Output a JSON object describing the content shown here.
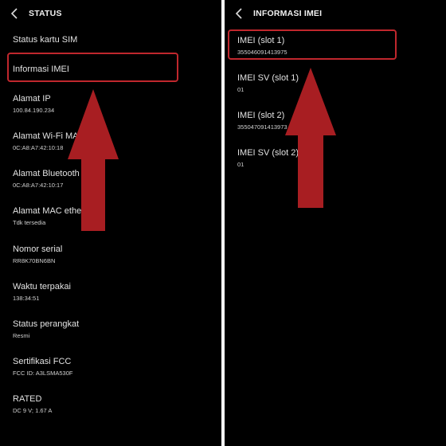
{
  "left": {
    "title": "STATUS",
    "items": [
      {
        "title": "Status kartu SIM",
        "sub": ""
      },
      {
        "title": "Informasi IMEI",
        "sub": ""
      },
      {
        "title": "Alamat IP",
        "sub": "100.84.190.234"
      },
      {
        "title": "Alamat Wi-Fi MAC",
        "sub": "0C:A8:A7:42:10:18"
      },
      {
        "title": "Alamat Bluetooth",
        "sub": "0C:A8:A7:42:10:17"
      },
      {
        "title": "Alamat MAC ethernet",
        "sub": "Tdk tersedia"
      },
      {
        "title": "Nomor serial",
        "sub": "RR8K70BN6BN"
      },
      {
        "title": "Waktu terpakai",
        "sub": "138:34:51"
      },
      {
        "title": "Status perangkat",
        "sub": "Resmi"
      },
      {
        "title": "Sertifikasi FCC",
        "sub": "FCC ID: A3LSMA530F"
      },
      {
        "title": "RATED",
        "sub": "DC 9 V; 1.67 A"
      }
    ]
  },
  "right": {
    "title": "INFORMASI IMEI",
    "items": [
      {
        "title": "IMEI (slot 1)",
        "sub": "355046091413975"
      },
      {
        "title": "IMEI SV (slot 1)",
        "sub": "01"
      },
      {
        "title": "IMEI (slot 2)",
        "sub": "355047091413973"
      },
      {
        "title": "IMEI SV (slot 2)",
        "sub": "01"
      }
    ]
  },
  "colors": {
    "background": "#000000",
    "text": "#e2e2e2",
    "highlight": "#c0272d",
    "arrow": "#a81e22"
  },
  "icons": [
    "back-chevron-icon"
  ]
}
